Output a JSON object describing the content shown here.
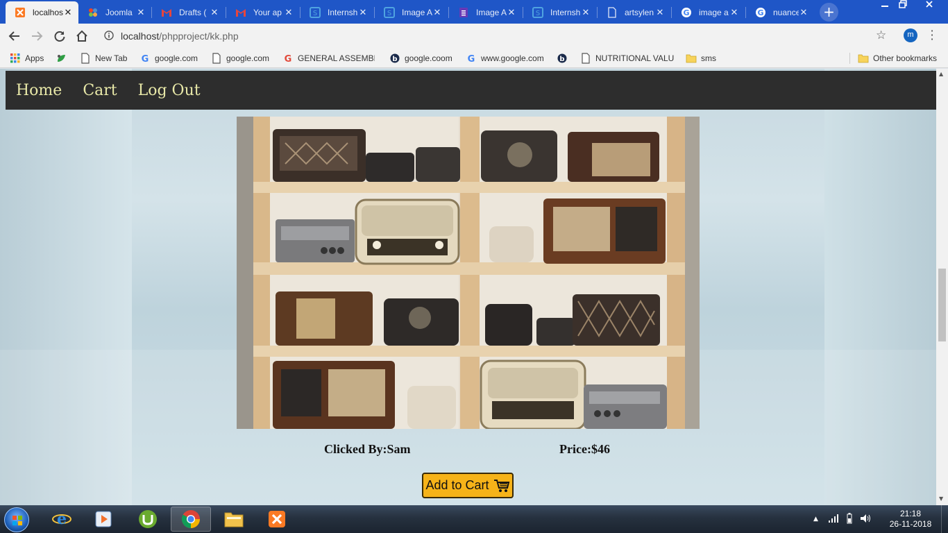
{
  "browser": {
    "tabs": [
      {
        "title": "localhost",
        "icon": "xampp-icon",
        "active": true
      },
      {
        "title": "Joomla",
        "icon": "joomla-icon"
      },
      {
        "title": "Drafts (",
        "icon": "gmail-icon"
      },
      {
        "title": "Your ap",
        "icon": "gmail-icon"
      },
      {
        "title": "Internsh",
        "icon": "internshala-icon"
      },
      {
        "title": "Image A",
        "icon": "internshala-icon"
      },
      {
        "title": "Image A",
        "icon": "forms-icon"
      },
      {
        "title": "Internsh",
        "icon": "internshala-icon"
      },
      {
        "title": "artsylen",
        "icon": "page-icon"
      },
      {
        "title": "image a",
        "icon": "google-icon"
      },
      {
        "title": "nuance",
        "icon": "google-icon"
      }
    ],
    "new_tab_label": "+",
    "url_host": "localhost",
    "url_path": "/phpproject/kk.php",
    "profile_initial": "m",
    "bookmarks": [
      {
        "label": "Apps",
        "icon": "apps-grid-icon"
      },
      {
        "label": "",
        "icon": "bookmark-leaf-icon"
      },
      {
        "label": "New Tab",
        "icon": "page-icon"
      },
      {
        "label": "google.com",
        "icon": "google-icon"
      },
      {
        "label": "google.com",
        "icon": "page-icon"
      },
      {
        "label": "GENERAL ASSEMBLY",
        "icon": "g-icon"
      },
      {
        "label": "google.coom",
        "icon": "bing-icon"
      },
      {
        "label": "www.google.com",
        "icon": "google-icon"
      },
      {
        "label": "",
        "icon": "bing-icon"
      },
      {
        "label": "NUTRITIONAL VALUE",
        "icon": "page-icon"
      },
      {
        "label": "sms",
        "icon": "folder-icon"
      }
    ],
    "other_bookmarks": "Other bookmarks"
  },
  "site": {
    "nav": [
      "Home",
      "Cart",
      "Log Out"
    ],
    "clicked_by": "Clicked By:Sam",
    "price": "Price:$46",
    "add_to_cart": "Add to Cart"
  },
  "taskbar": {
    "apps": [
      "internet-explorer-icon",
      "media-player-icon",
      "utorrent-icon",
      "chrome-icon",
      "file-explorer-icon",
      "xampp-icon"
    ],
    "time": "21:18",
    "date": "26-11-2018"
  },
  "colors": {
    "tab_strip": "#1f56c7",
    "nav_bg": "#2d2d2d",
    "nav_link": "#e8e8a8",
    "cart_button": "#f6b319"
  }
}
